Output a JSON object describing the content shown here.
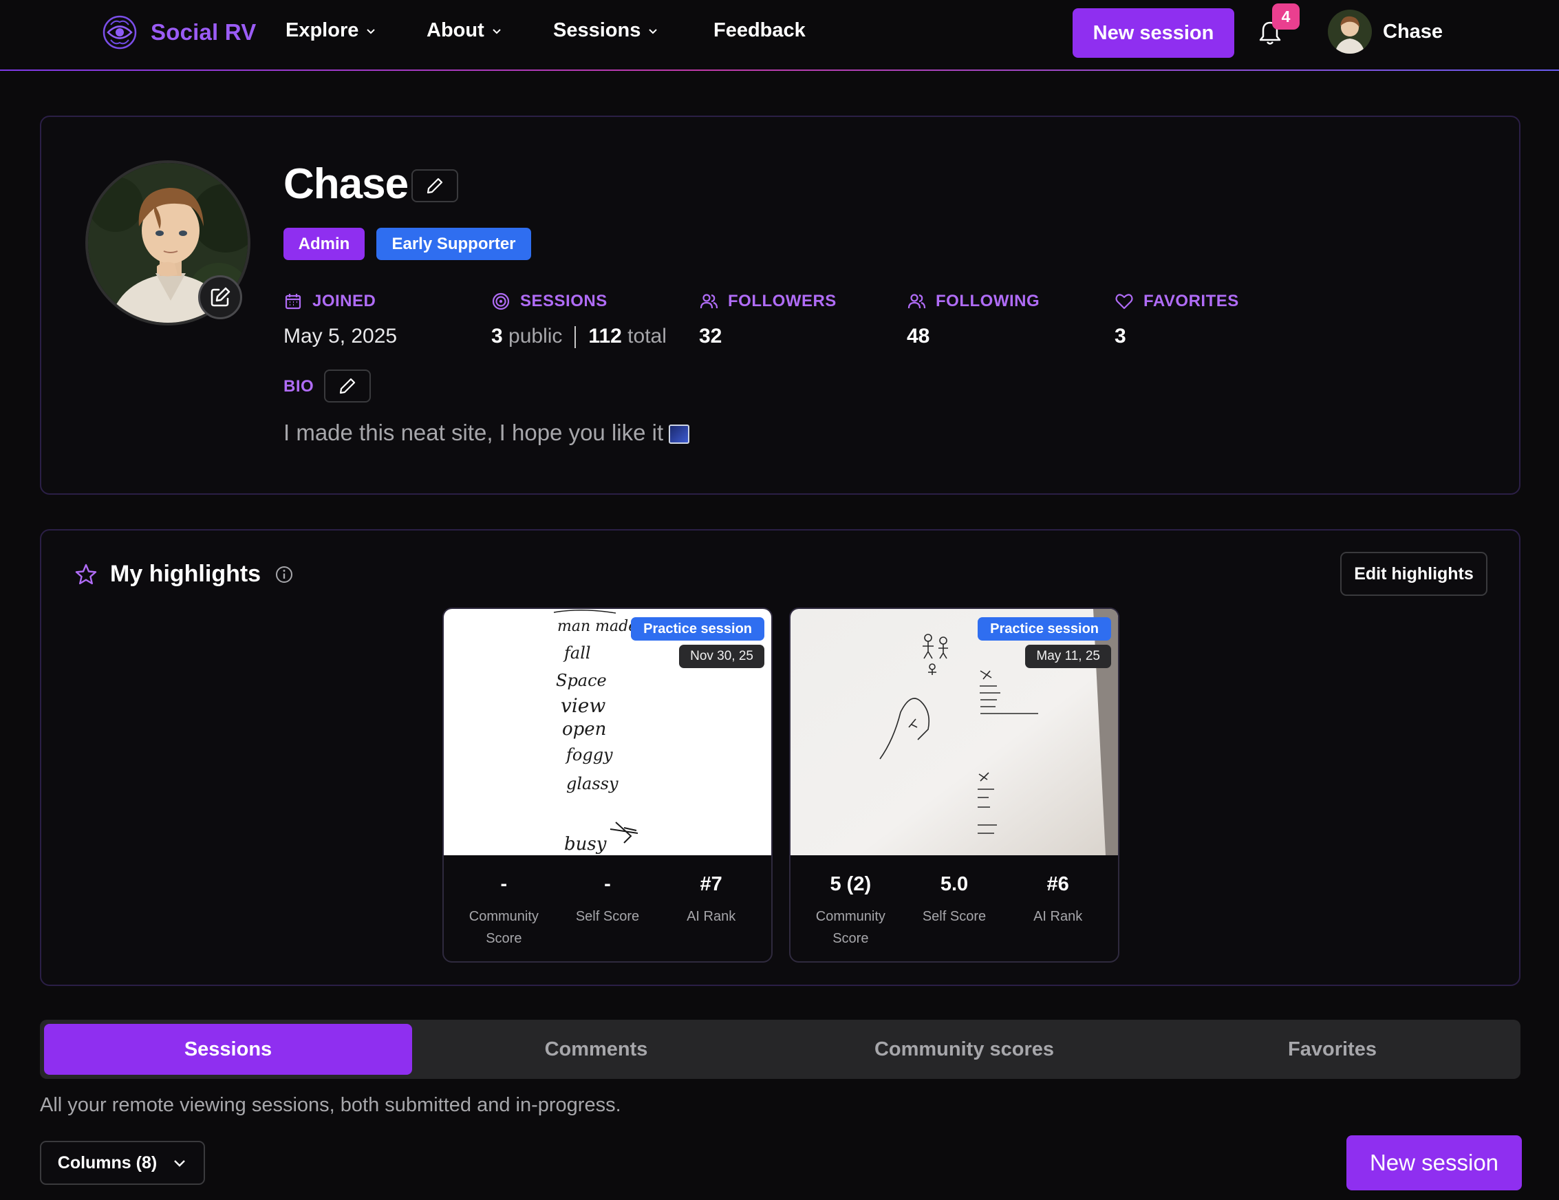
{
  "nav": {
    "brand": "Social RV",
    "items": [
      {
        "label": "Explore"
      },
      {
        "label": "About"
      },
      {
        "label": "Sessions"
      },
      {
        "label": "Feedback"
      }
    ],
    "new_session": "New session",
    "notification_count": "4",
    "username": "Chase"
  },
  "profile": {
    "name": "Chase",
    "badges": [
      "Admin",
      "Early Supporter"
    ],
    "stats": {
      "joined_label": "JOINED",
      "joined_value": "May 5, 2025",
      "sessions_label": "SESSIONS",
      "sessions_public": "3",
      "sessions_public_word": "public",
      "sessions_total": "112",
      "sessions_total_word": "total",
      "followers_label": "FOLLOWERS",
      "followers_value": "32",
      "following_label": "FOLLOWING",
      "following_value": "48",
      "favorites_label": "FAVORITES",
      "favorites_value": "3"
    },
    "bio_label": "BIO",
    "bio_text": "I made this neat site, I hope you like it"
  },
  "highlights": {
    "title": "My highlights",
    "edit_label": "Edit highlights",
    "cards": [
      {
        "tag": "Practice session",
        "date": "Nov 30, 25",
        "sketch_words": [
          "man made",
          "fall",
          "Space",
          "view",
          "open",
          "foggy",
          "glassy",
          "busy"
        ],
        "community_score": "-",
        "community_label": "Community Score",
        "self_score": "-",
        "self_label": "Self Score",
        "ai_rank": "#7",
        "ai_label": "AI Rank"
      },
      {
        "tag": "Practice session",
        "date": "May 11, 25",
        "community_score": "5 (2)",
        "community_label": "Community Score",
        "self_score": "5.0",
        "self_label": "Self Score",
        "ai_rank": "#6",
        "ai_label": "AI Rank"
      }
    ]
  },
  "tabs": [
    {
      "label": "Sessions",
      "active": true
    },
    {
      "label": "Comments",
      "active": false
    },
    {
      "label": "Community scores",
      "active": false
    },
    {
      "label": "Favorites",
      "active": false
    }
  ],
  "sessions_tab": {
    "description": "All your remote viewing sessions, both submitted and in-progress.",
    "columns_label": "Columns (8)",
    "new_session": "New session"
  },
  "colors": {
    "accent": "#8f2ff0",
    "accent_text": "#b06cf6",
    "blue_badge": "#2f6ef0",
    "notification": "#ea3f8f",
    "background": "#0b0a0c"
  }
}
